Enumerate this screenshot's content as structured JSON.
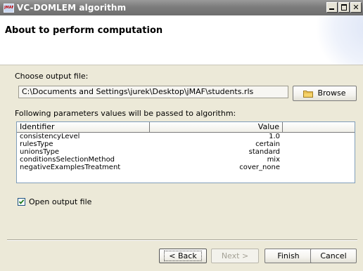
{
  "window": {
    "title": "VC-DOMLEM algorithm",
    "app_icon_text": "jMAF"
  },
  "header": {
    "title": "About to perform computation"
  },
  "output": {
    "label": "Choose output file:",
    "path": "C:\\Documents and Settings\\jurek\\Desktop\\jMAF\\students.rls",
    "browse_label": "Browse"
  },
  "params": {
    "label": "Following parameters values will be passed to algorithm:",
    "columns": [
      "Identifier",
      "Value"
    ],
    "rows": [
      {
        "identifier": "consistencyLevel",
        "value": "1.0"
      },
      {
        "identifier": "rulesType",
        "value": "certain"
      },
      {
        "identifier": "unionsType",
        "value": "standard"
      },
      {
        "identifier": "conditionsSelectionMethod",
        "value": "mix"
      },
      {
        "identifier": "negativeExamplesTreatment",
        "value": "cover_none"
      }
    ]
  },
  "open_output": {
    "label": "Open output file",
    "checked": true
  },
  "buttons": {
    "back": "< Back",
    "next": "Next >",
    "finish": "Finish",
    "cancel": "Cancel"
  },
  "colors": {
    "titlebar": "#7c7c7c",
    "dialog_bg": "#ECE9D8",
    "table_border": "#7f9db9"
  },
  "icons": {
    "app": "jmaf-app-icon",
    "browse": "folder-icon",
    "minimize": "minimize-icon",
    "maximize": "maximize-icon",
    "close": "close-icon",
    "checkbox": "checkmark-icon"
  }
}
